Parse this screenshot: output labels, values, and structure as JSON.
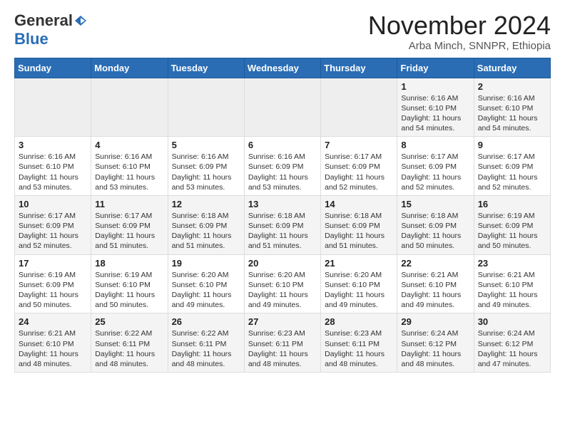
{
  "header": {
    "logo_general": "General",
    "logo_blue": "Blue",
    "month_title": "November 2024",
    "location": "Arba Minch, SNNPR, Ethiopia"
  },
  "weekdays": [
    "Sunday",
    "Monday",
    "Tuesday",
    "Wednesday",
    "Thursday",
    "Friday",
    "Saturday"
  ],
  "weeks": [
    [
      {
        "day": "",
        "info": ""
      },
      {
        "day": "",
        "info": ""
      },
      {
        "day": "",
        "info": ""
      },
      {
        "day": "",
        "info": ""
      },
      {
        "day": "",
        "info": ""
      },
      {
        "day": "1",
        "info": "Sunrise: 6:16 AM\nSunset: 6:10 PM\nDaylight: 11 hours\nand 54 minutes."
      },
      {
        "day": "2",
        "info": "Sunrise: 6:16 AM\nSunset: 6:10 PM\nDaylight: 11 hours\nand 54 minutes."
      }
    ],
    [
      {
        "day": "3",
        "info": "Sunrise: 6:16 AM\nSunset: 6:10 PM\nDaylight: 11 hours\nand 53 minutes."
      },
      {
        "day": "4",
        "info": "Sunrise: 6:16 AM\nSunset: 6:10 PM\nDaylight: 11 hours\nand 53 minutes."
      },
      {
        "day": "5",
        "info": "Sunrise: 6:16 AM\nSunset: 6:09 PM\nDaylight: 11 hours\nand 53 minutes."
      },
      {
        "day": "6",
        "info": "Sunrise: 6:16 AM\nSunset: 6:09 PM\nDaylight: 11 hours\nand 53 minutes."
      },
      {
        "day": "7",
        "info": "Sunrise: 6:17 AM\nSunset: 6:09 PM\nDaylight: 11 hours\nand 52 minutes."
      },
      {
        "day": "8",
        "info": "Sunrise: 6:17 AM\nSunset: 6:09 PM\nDaylight: 11 hours\nand 52 minutes."
      },
      {
        "day": "9",
        "info": "Sunrise: 6:17 AM\nSunset: 6:09 PM\nDaylight: 11 hours\nand 52 minutes."
      }
    ],
    [
      {
        "day": "10",
        "info": "Sunrise: 6:17 AM\nSunset: 6:09 PM\nDaylight: 11 hours\nand 52 minutes."
      },
      {
        "day": "11",
        "info": "Sunrise: 6:17 AM\nSunset: 6:09 PM\nDaylight: 11 hours\nand 51 minutes."
      },
      {
        "day": "12",
        "info": "Sunrise: 6:18 AM\nSunset: 6:09 PM\nDaylight: 11 hours\nand 51 minutes."
      },
      {
        "day": "13",
        "info": "Sunrise: 6:18 AM\nSunset: 6:09 PM\nDaylight: 11 hours\nand 51 minutes."
      },
      {
        "day": "14",
        "info": "Sunrise: 6:18 AM\nSunset: 6:09 PM\nDaylight: 11 hours\nand 51 minutes."
      },
      {
        "day": "15",
        "info": "Sunrise: 6:18 AM\nSunset: 6:09 PM\nDaylight: 11 hours\nand 50 minutes."
      },
      {
        "day": "16",
        "info": "Sunrise: 6:19 AM\nSunset: 6:09 PM\nDaylight: 11 hours\nand 50 minutes."
      }
    ],
    [
      {
        "day": "17",
        "info": "Sunrise: 6:19 AM\nSunset: 6:09 PM\nDaylight: 11 hours\nand 50 minutes."
      },
      {
        "day": "18",
        "info": "Sunrise: 6:19 AM\nSunset: 6:10 PM\nDaylight: 11 hours\nand 50 minutes."
      },
      {
        "day": "19",
        "info": "Sunrise: 6:20 AM\nSunset: 6:10 PM\nDaylight: 11 hours\nand 49 minutes."
      },
      {
        "day": "20",
        "info": "Sunrise: 6:20 AM\nSunset: 6:10 PM\nDaylight: 11 hours\nand 49 minutes."
      },
      {
        "day": "21",
        "info": "Sunrise: 6:20 AM\nSunset: 6:10 PM\nDaylight: 11 hours\nand 49 minutes."
      },
      {
        "day": "22",
        "info": "Sunrise: 6:21 AM\nSunset: 6:10 PM\nDaylight: 11 hours\nand 49 minutes."
      },
      {
        "day": "23",
        "info": "Sunrise: 6:21 AM\nSunset: 6:10 PM\nDaylight: 11 hours\nand 49 minutes."
      }
    ],
    [
      {
        "day": "24",
        "info": "Sunrise: 6:21 AM\nSunset: 6:10 PM\nDaylight: 11 hours\nand 48 minutes."
      },
      {
        "day": "25",
        "info": "Sunrise: 6:22 AM\nSunset: 6:11 PM\nDaylight: 11 hours\nand 48 minutes."
      },
      {
        "day": "26",
        "info": "Sunrise: 6:22 AM\nSunset: 6:11 PM\nDaylight: 11 hours\nand 48 minutes."
      },
      {
        "day": "27",
        "info": "Sunrise: 6:23 AM\nSunset: 6:11 PM\nDaylight: 11 hours\nand 48 minutes."
      },
      {
        "day": "28",
        "info": "Sunrise: 6:23 AM\nSunset: 6:11 PM\nDaylight: 11 hours\nand 48 minutes."
      },
      {
        "day": "29",
        "info": "Sunrise: 6:24 AM\nSunset: 6:12 PM\nDaylight: 11 hours\nand 48 minutes."
      },
      {
        "day": "30",
        "info": "Sunrise: 6:24 AM\nSunset: 6:12 PM\nDaylight: 11 hours\nand 47 minutes."
      }
    ]
  ]
}
